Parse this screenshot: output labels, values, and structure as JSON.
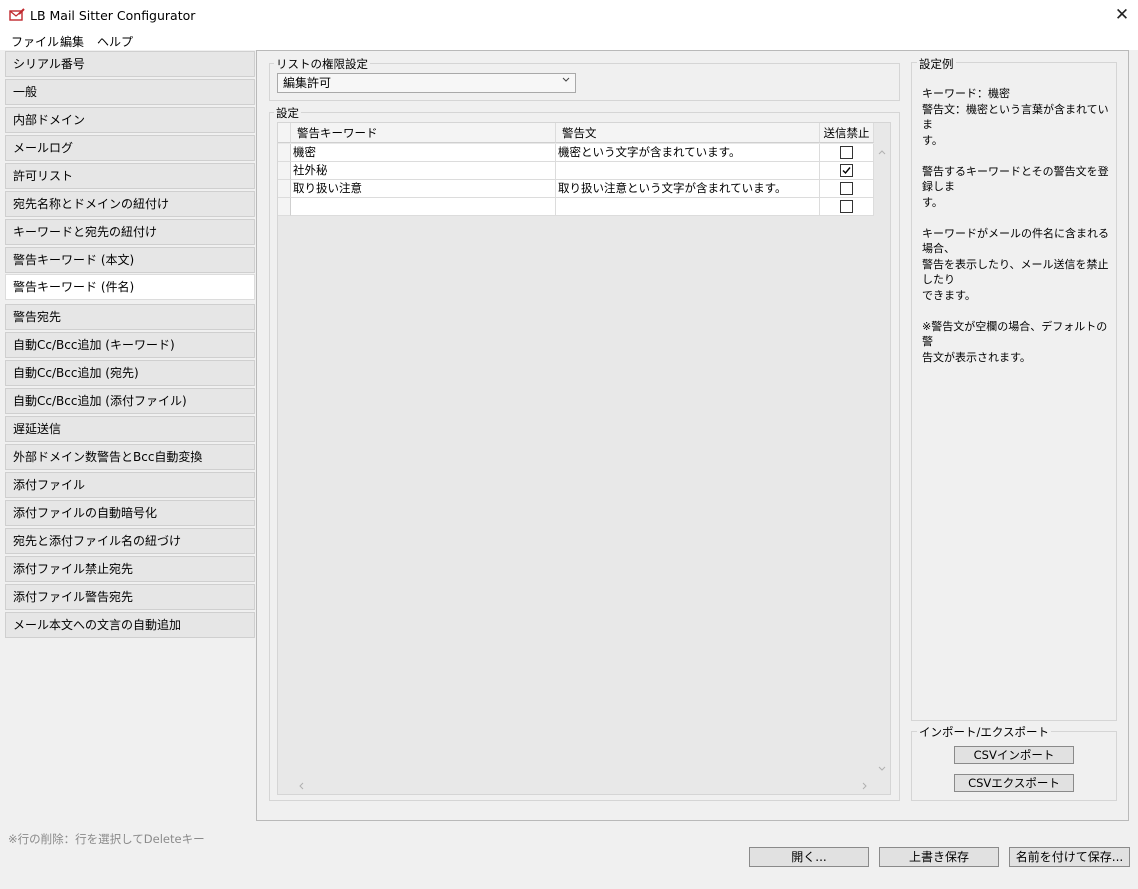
{
  "window": {
    "title": "LB Mail Sitter Configurator"
  },
  "menu": [
    "ファイル",
    "編集",
    "ヘルプ"
  ],
  "nav": {
    "items": [
      "シリアル番号",
      "一般",
      "内部ドメイン",
      "メールログ",
      "許可リスト",
      "宛先名称とドメインの紐付け",
      "キーワードと宛先の紐付け",
      "警告キーワード (本文)",
      "警告キーワード (件名)",
      "警告宛先",
      "自動Cc/Bcc追加 (キーワード)",
      "自動Cc/Bcc追加 (宛先)",
      "自動Cc/Bcc追加 (添付ファイル)",
      "遅延送信",
      "外部ドメイン数警告とBcc自動変換",
      "添付ファイル",
      "添付ファイルの自動暗号化",
      "宛先と添付ファイル名の紐づけ",
      "添付ファイル禁止宛先",
      "添付ファイル警告宛先",
      "メール本文への文言の自動追加"
    ],
    "selected": "警告キーワード (件名)"
  },
  "permission": {
    "label": "リストの権限設定",
    "value": "編集許可"
  },
  "settings": {
    "label": "設定",
    "columns": [
      "警告キーワード",
      "警告文",
      "送信禁止"
    ],
    "rows": [
      {
        "keyword": "機密",
        "message": "機密という文字が含まれています。",
        "blocked": false
      },
      {
        "keyword": "社外秘",
        "message": "",
        "blocked": true
      },
      {
        "keyword": "取り扱い注意",
        "message": "取り扱い注意という文字が含まれています。",
        "blocked": false
      },
      {
        "keyword": "",
        "message": "",
        "blocked": false
      }
    ]
  },
  "example": {
    "label": "設定例",
    "text": "キーワード：機密\n警告文：機密という言葉が含まれていま\nす。\n\n警告するキーワードとその警告文を登録しま\nす。\n\nキーワードがメールの件名に含まれる場合、\n警告を表示したり、メール送信を禁止したり\nできます。\n\n※警告文が空欄の場合、デフォルトの警\n告文が表示されます。"
  },
  "import_export": {
    "label": "インポート/エクスポート",
    "import_label": "CSVインポート",
    "export_label": "CSVエクスポート"
  },
  "footer": {
    "hint": "※行の削除：行を選択してDeleteキー",
    "open_label": "開く...",
    "overwrite_label": "上書き保存",
    "save_as_label": "名前を付けて保存..."
  }
}
